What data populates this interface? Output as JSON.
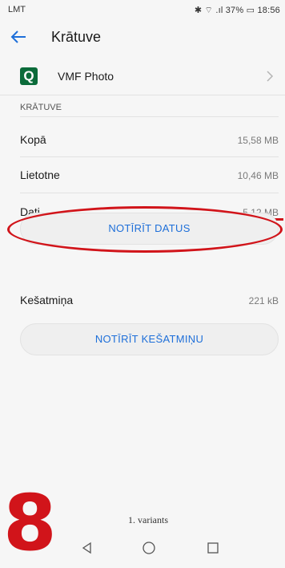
{
  "status_bar": {
    "left": "LMT",
    "right": "✱ ⌔ .ıl 37% ▭ 18:56"
  },
  "header": {
    "title": "Krātuve"
  },
  "app": {
    "name": "VMF Photo",
    "icon_letter": "Q"
  },
  "section": {
    "title": "KRĀTUVE"
  },
  "rows": [
    {
      "label": "Kopā",
      "value": "15,58 MB"
    },
    {
      "label": "Lietotne",
      "value": "10,46 MB"
    },
    {
      "label": "Dati",
      "value": "5,12 MB"
    },
    {
      "label": "Kešatmiņa",
      "value": "221 kB"
    }
  ],
  "buttons": {
    "clear_data": "NOTĪRĪT DATUS",
    "clear_cache": "NOTĪRĪT KEŠATMIŅU"
  },
  "annotation": {
    "step_number": "8",
    "caption": "1. variants"
  },
  "colors": {
    "accent": "#1e6fd9",
    "annotation_red": "#d1141a",
    "app_icon": "#0b6b3a"
  }
}
